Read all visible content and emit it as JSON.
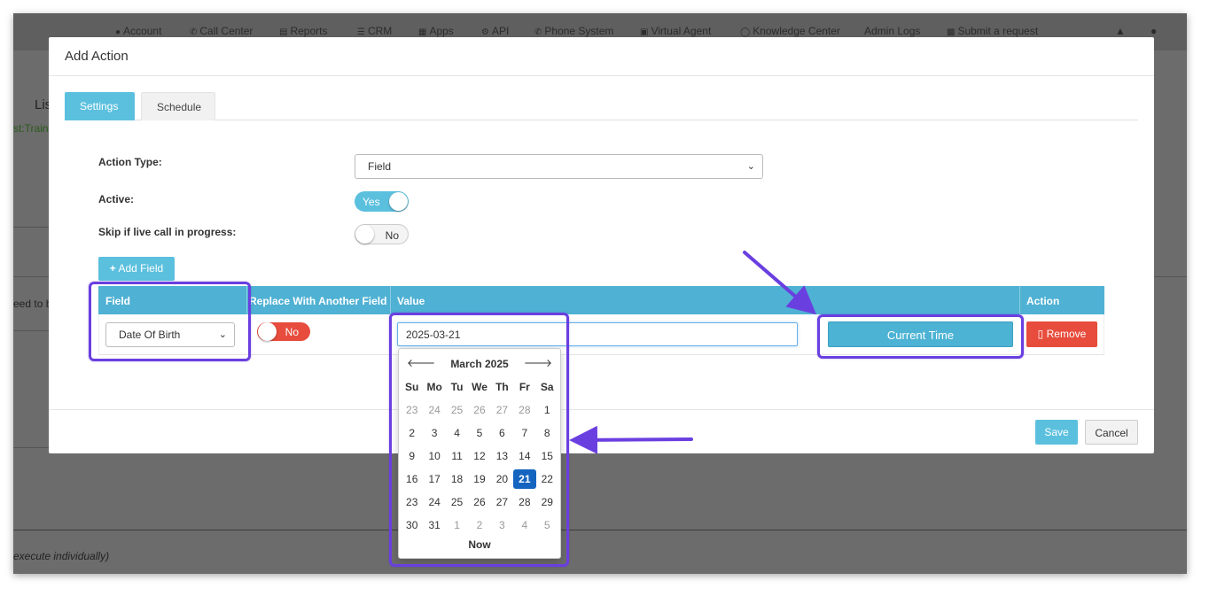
{
  "topnav": {
    "items": [
      {
        "label": "Account",
        "icon": "user-icon"
      },
      {
        "label": "Call Center",
        "icon": "phone-icon"
      },
      {
        "label": "Reports",
        "icon": "bar-chart-icon"
      },
      {
        "label": "CRM",
        "icon": "list-icon"
      },
      {
        "label": "Apps",
        "icon": "grid-icon"
      },
      {
        "label": "API",
        "icon": "gear-icon"
      },
      {
        "label": "Phone System",
        "icon": "phone-icon"
      },
      {
        "label": "Virtual Agent",
        "icon": "monitor-icon"
      },
      {
        "label": "Knowledge Center",
        "icon": "lightbulb-icon"
      },
      {
        "label": "Admin Logs",
        "icon": ""
      },
      {
        "label": "Submit a request",
        "icon": "ticket-icon"
      }
    ]
  },
  "background": {
    "fragment_1": "Lis",
    "fragment_2": "st:Train",
    "fragment_3": "eed to be",
    "fragment_4": "execute individually)"
  },
  "modal": {
    "title": "Add Action",
    "tabs": [
      {
        "label": "Settings",
        "active": true
      },
      {
        "label": "Schedule",
        "active": false
      }
    ],
    "action_type": {
      "label": "Action Type:",
      "value": "Field"
    },
    "active": {
      "label": "Active:",
      "value": "Yes"
    },
    "skip": {
      "label": "Skip if live call in progress:",
      "value": "No"
    },
    "add_field_label": "Add Field",
    "table": {
      "headers": [
        "Field",
        "Replace With Another Field",
        "Value",
        "Action"
      ],
      "row": {
        "field": "Date Of Birth",
        "replace": "No",
        "value": "2025-03-21",
        "current_time_label": "Current Time",
        "remove_label": "Remove"
      }
    },
    "save_label": "Save",
    "cancel_label": "Cancel"
  },
  "datepicker": {
    "title": "March 2025",
    "prev": "🡐",
    "next": "🡒",
    "weekdays": [
      "Su",
      "Mo",
      "Tu",
      "We",
      "Th",
      "Fr",
      "Sa"
    ],
    "weeks": [
      [
        [
          "23",
          true
        ],
        [
          "24",
          true
        ],
        [
          "25",
          true
        ],
        [
          "26",
          true
        ],
        [
          "27",
          true
        ],
        [
          "28",
          true
        ],
        [
          "1",
          false
        ]
      ],
      [
        [
          "2",
          false
        ],
        [
          "3",
          false
        ],
        [
          "4",
          false
        ],
        [
          "5",
          false
        ],
        [
          "6",
          false
        ],
        [
          "7",
          false
        ],
        [
          "8",
          false
        ]
      ],
      [
        [
          "9",
          false
        ],
        [
          "10",
          false
        ],
        [
          "11",
          false
        ],
        [
          "12",
          false
        ],
        [
          "13",
          false
        ],
        [
          "14",
          false
        ],
        [
          "15",
          false
        ]
      ],
      [
        [
          "16",
          false
        ],
        [
          "17",
          false
        ],
        [
          "18",
          false
        ],
        [
          "19",
          false
        ],
        [
          "20",
          false
        ],
        [
          "21",
          false
        ],
        [
          "22",
          false
        ]
      ],
      [
        [
          "23",
          false
        ],
        [
          "24",
          false
        ],
        [
          "25",
          false
        ],
        [
          "26",
          false
        ],
        [
          "27",
          false
        ],
        [
          "28",
          false
        ],
        [
          "29",
          false
        ]
      ],
      [
        [
          "30",
          false
        ],
        [
          "31",
          false
        ],
        [
          "1",
          true
        ],
        [
          "2",
          true
        ],
        [
          "3",
          true
        ],
        [
          "4",
          true
        ],
        [
          "5",
          true
        ]
      ]
    ],
    "selected_day": "21",
    "now_label": "Now"
  },
  "colors": {
    "accent": "#5bc0de",
    "table_header": "#4fb1d3",
    "danger": "#e74c3c",
    "selected_day": "#1565c0",
    "annotation": "#6a3fe0"
  }
}
